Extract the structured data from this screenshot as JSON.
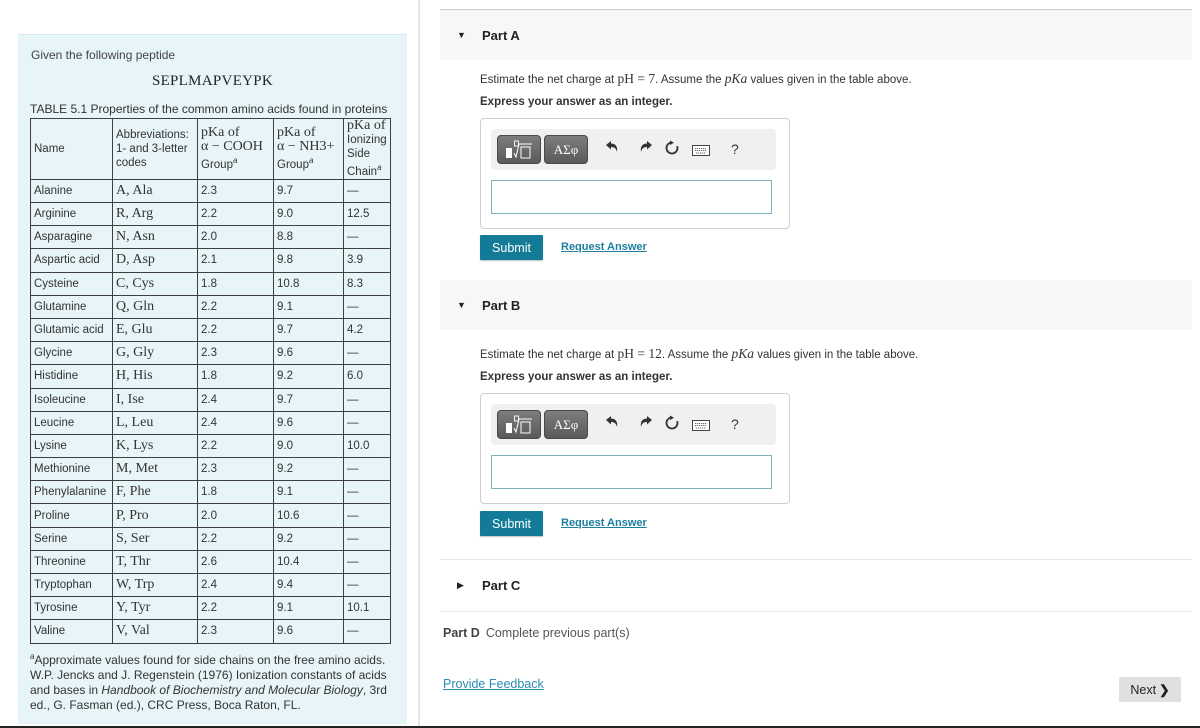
{
  "intro": {
    "given_text": "Given the following peptide",
    "peptide": "SEPLMAPVEYPK",
    "table_caption": "TABLE 5.1 Properties of the common amino acids found in proteins",
    "headers": {
      "name": "Name",
      "abbr_line1": "Abbreviations:",
      "abbr_line2": "1- and 3-letter",
      "abbr_line3": "codes",
      "cooh_pka": "pKa of",
      "cooh_group": "α − COOH",
      "cooh_suffix": "Group",
      "nh3_pka": "pKa of",
      "nh3_group": "α − NH3+",
      "nh3_suffix": "Group",
      "side_pka": "pKa of",
      "side_line2": "Ionizing",
      "side_line3": "Side",
      "side_line4": "Chain",
      "footnote_mark": "a"
    },
    "rows": [
      {
        "name": "Alanine",
        "abbr": "A, Ala",
        "cooh": "2.3",
        "nh3": "9.7",
        "side": "—"
      },
      {
        "name": "Arginine",
        "abbr": "R, Arg",
        "cooh": "2.2",
        "nh3": "9.0",
        "side": "12.5"
      },
      {
        "name": "Asparagine",
        "abbr": "N, Asn",
        "cooh": "2.0",
        "nh3": "8.8",
        "side": "—"
      },
      {
        "name": "Aspartic acid",
        "abbr": "D, Asp",
        "cooh": "2.1",
        "nh3": "9.8",
        "side": "3.9"
      },
      {
        "name": "Cysteine",
        "abbr": "C, Cys",
        "cooh": "1.8",
        "nh3": "10.8",
        "side": "8.3"
      },
      {
        "name": "Glutamine",
        "abbr": "Q, Gln",
        "cooh": "2.2",
        "nh3": "9.1",
        "side": "—"
      },
      {
        "name": "Glutamic acid",
        "abbr": "E, Glu",
        "cooh": "2.2",
        "nh3": "9.7",
        "side": "4.2"
      },
      {
        "name": "Glycine",
        "abbr": "G, Gly",
        "cooh": "2.3",
        "nh3": "9.6",
        "side": "—"
      },
      {
        "name": "Histidine",
        "abbr": "H, His",
        "cooh": "1.8",
        "nh3": "9.2",
        "side": "6.0"
      },
      {
        "name": "Isoleucine",
        "abbr": "I, Ise",
        "cooh": "2.4",
        "nh3": "9.7",
        "side": "—"
      },
      {
        "name": "Leucine",
        "abbr": "L, Leu",
        "cooh": "2.4",
        "nh3": "9.6",
        "side": "—"
      },
      {
        "name": "Lysine",
        "abbr": "K, Lys",
        "cooh": "2.2",
        "nh3": "9.0",
        "side": "10.0"
      },
      {
        "name": "Methionine",
        "abbr": "M, Met",
        "cooh": "2.3",
        "nh3": "9.2",
        "side": "—"
      },
      {
        "name": "Phenylalanine",
        "abbr": "F, Phe",
        "cooh": "1.8",
        "nh3": "9.1",
        "side": "—"
      },
      {
        "name": "Proline",
        "abbr": "P, Pro",
        "cooh": "2.0",
        "nh3": "10.6",
        "side": "—"
      },
      {
        "name": "Serine",
        "abbr": "S, Ser",
        "cooh": "2.2",
        "nh3": "9.2",
        "side": "—"
      },
      {
        "name": "Threonine",
        "abbr": "T, Thr",
        "cooh": "2.6",
        "nh3": "10.4",
        "side": "—"
      },
      {
        "name": "Tryptophan",
        "abbr": "W, Trp",
        "cooh": "2.4",
        "nh3": "9.4",
        "side": "—"
      },
      {
        "name": "Tyrosine",
        "abbr": "Y, Tyr",
        "cooh": "2.2",
        "nh3": "9.1",
        "side": "10.1"
      },
      {
        "name": "Valine",
        "abbr": "V, Val",
        "cooh": "2.3",
        "nh3": "9.6",
        "side": "—"
      }
    ],
    "footnote": {
      "mark": "a",
      "text_before": "Approximate values found for side chains on the free amino acids. W.P. Jencks and J. Regenstein (1976) Ionization constants of acids and bases in ",
      "book_title": "Handbook of Biochemistry and Molecular Biology",
      "text_after": ", 3rd ed., G. Fasman (ed.), CRC Press, Boca Raton, FL."
    }
  },
  "parts": {
    "a": {
      "label": "Part A",
      "expanded": true,
      "question_prefix": "Estimate the net charge at ",
      "question_math": "pH = 7",
      "question_mid": ". Assume the ",
      "question_math2": "pKa",
      "question_suffix": " values given in the table above.",
      "instruction": "Express your answer as an integer.",
      "input_value": "",
      "submit_label": "Submit",
      "request_label": "Request Answer"
    },
    "b": {
      "label": "Part B",
      "expanded": true,
      "question_prefix": "Estimate the net charge at ",
      "question_math": "pH = 12",
      "question_mid": ". Assume the ",
      "question_math2": "pKa",
      "question_suffix": " values given in the table above.",
      "instruction": "Express your answer as an integer.",
      "input_value": "",
      "submit_label": "Submit",
      "request_label": "Request Answer"
    },
    "c": {
      "label": "Part C",
      "expanded": false
    },
    "d": {
      "label": "Part D",
      "status": "Complete previous part(s)"
    }
  },
  "toolbar": {
    "symbols_label": "ΑΣφ",
    "help_label": "?",
    "icons": [
      "templates-icon",
      "symbols-icon",
      "undo-icon",
      "redo-icon",
      "reset-icon",
      "keyboard-icon",
      "help-icon"
    ]
  },
  "footer": {
    "feedback_label": "Provide Feedback",
    "next_label": "Next"
  }
}
